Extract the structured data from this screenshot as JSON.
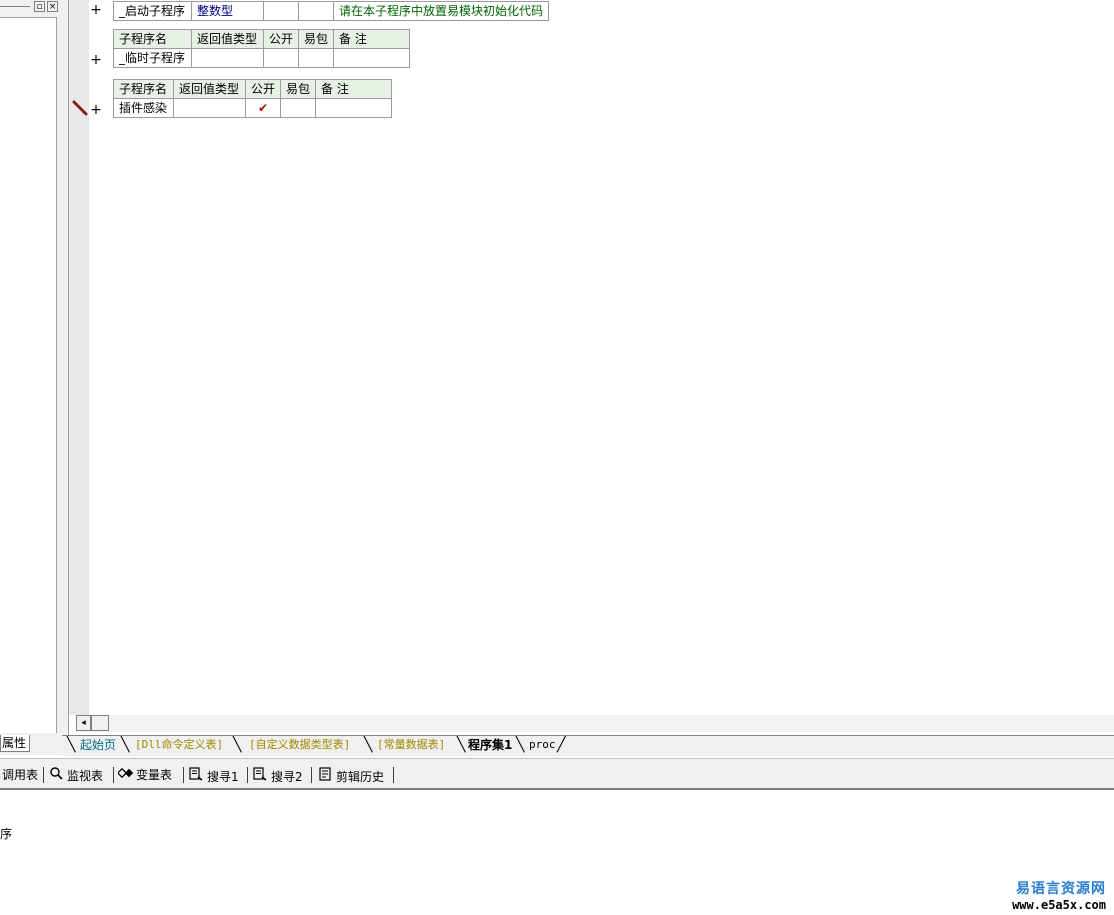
{
  "left_panel": {
    "restore_button": "▫",
    "close_button": "×",
    "tab_label": "属性"
  },
  "subroutines": [
    {
      "name": "_启动子程序",
      "return_type": "整数型",
      "public": "",
      "easy_pack": "",
      "note": "请在本子程序中放置易模块初始化代码"
    },
    {
      "headers": [
        "子程序名",
        "返回值类型",
        "公开",
        "易包",
        "备 注"
      ],
      "name": "_临时子程序",
      "return_type": "",
      "public": "",
      "easy_pack": "",
      "note": ""
    },
    {
      "headers": [
        "子程序名",
        "返回值类型",
        "公开",
        "易包",
        "备 注"
      ],
      "name": "插件感染",
      "return_type": "",
      "public": "✔",
      "easy_pack": "",
      "note": ""
    }
  ],
  "gutter": {
    "expand_symbol": "+"
  },
  "scrollbar": {
    "left_arrow": "◂"
  },
  "tabs": [
    {
      "label": "起始页"
    },
    {
      "label": "[Dll命令定义表]"
    },
    {
      "label": "[自定义数据类型表]"
    },
    {
      "label": "[常量数据表]"
    },
    {
      "label": "程序集1"
    },
    {
      "label": "proc"
    }
  ],
  "bottom_toolbar": [
    {
      "label": "调用表",
      "icon": ""
    },
    {
      "label": "监视表",
      "icon": "magnifier-icon"
    },
    {
      "label": "变量表",
      "icon": "variable-icon"
    },
    {
      "label": "搜寻1",
      "icon": "search-doc-icon"
    },
    {
      "label": "搜寻2",
      "icon": "search-doc-icon"
    },
    {
      "label": "剪辑历史",
      "icon": "clipboard-icon"
    }
  ],
  "output": {
    "text": "序"
  },
  "watermark": {
    "cn": "易语言资源网",
    "url": "www.e5a5x.com"
  },
  "colors": {
    "header_bg": "#e6f0e4",
    "note_green": "#006400",
    "type_navy": "#000080",
    "check_red": "#b00000"
  }
}
